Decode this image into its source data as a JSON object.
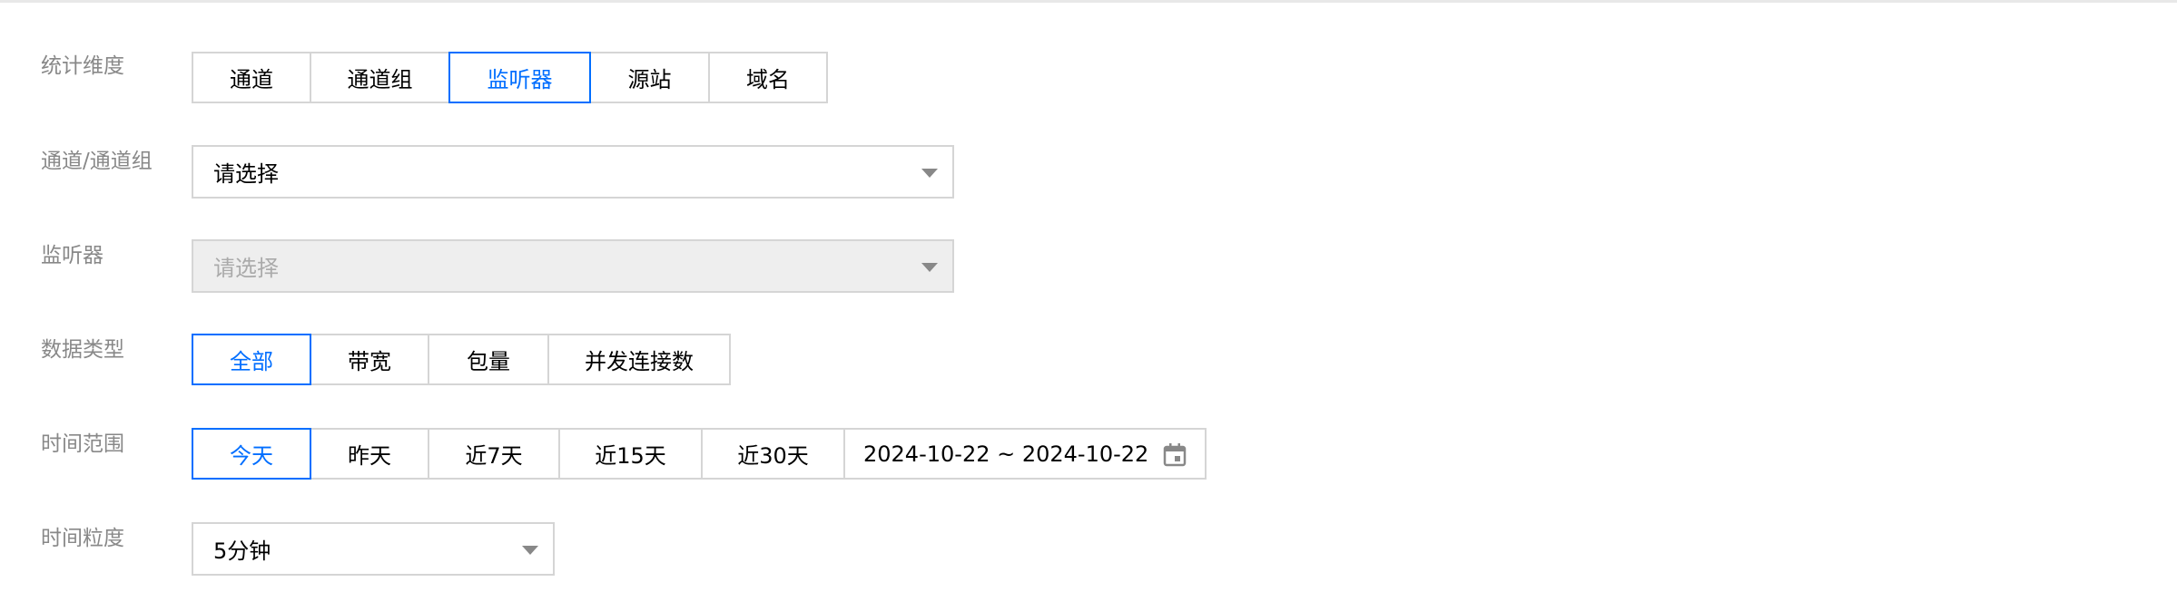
{
  "filters": {
    "dimension": {
      "label": "统计维度",
      "options": [
        {
          "label": "通道",
          "active": false
        },
        {
          "label": "通道组",
          "active": false
        },
        {
          "label": "监听器",
          "active": true
        },
        {
          "label": "源站",
          "active": false
        },
        {
          "label": "域名",
          "active": false
        }
      ]
    },
    "channel": {
      "label": "通道/通道组",
      "value": "请选择"
    },
    "listener": {
      "label": "监听器",
      "placeholder": "请选择",
      "disabled": true
    },
    "data_type": {
      "label": "数据类型",
      "options": [
        {
          "label": "全部",
          "active": true
        },
        {
          "label": "带宽",
          "active": false
        },
        {
          "label": "包量",
          "active": false
        },
        {
          "label": "并发连接数",
          "active": false
        }
      ]
    },
    "time_range": {
      "label": "时间范围",
      "options": [
        {
          "label": "今天",
          "active": true
        },
        {
          "label": "昨天",
          "active": false
        },
        {
          "label": "近7天",
          "active": false
        },
        {
          "label": "近15天",
          "active": false
        },
        {
          "label": "近30天",
          "active": false
        }
      ],
      "date_range": "2024-10-22 ~ 2024-10-22",
      "icon": "calendar-icon"
    },
    "granularity": {
      "label": "时间粒度",
      "value": "5分钟"
    }
  },
  "colors": {
    "accent": "#006eff",
    "border": "#d5d5d5",
    "label": "#888888",
    "disabled_bg": "#eeeeee"
  }
}
